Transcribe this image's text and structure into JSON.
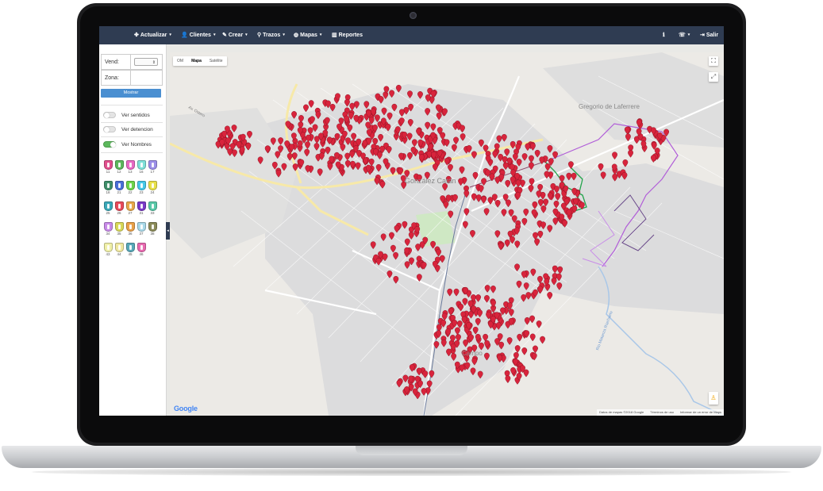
{
  "navbar": {
    "items": [
      {
        "label": "Actualizar",
        "icon": "refresh-icon",
        "glyph": "✤",
        "caret": true
      },
      {
        "label": "Clientes",
        "icon": "user-icon",
        "glyph": "👤",
        "caret": true
      },
      {
        "label": "Crear",
        "icon": "edit-icon",
        "glyph": "✎",
        "caret": true
      },
      {
        "label": "Trazos",
        "icon": "map-marker-icon",
        "glyph": "⚲",
        "caret": true
      },
      {
        "label": "Mapas",
        "icon": "globe-icon",
        "glyph": "◍",
        "caret": true
      },
      {
        "label": "Reportes",
        "icon": "bar-chart-icon",
        "glyph": "▥",
        "caret": false
      }
    ],
    "right": {
      "info_glyph": "ℹ",
      "phone_glyph": "☏",
      "logout_label": "Salir",
      "logout_glyph": "⇥"
    }
  },
  "sidebar": {
    "vend_label": "Vend:",
    "vend_value": "",
    "zona_label": "Zona:",
    "zona_value": "",
    "mostrar_label": "Mostrar",
    "toggles": [
      {
        "label": "Ver sentidos",
        "on": false
      },
      {
        "label": "Ver detencion",
        "on": false
      },
      {
        "label": "Ver Nombres",
        "on": true
      }
    ],
    "vendors": [
      {
        "num": "11",
        "color": "#e14f8d"
      },
      {
        "num": "12",
        "color": "#5cb85c"
      },
      {
        "num": "13",
        "color": "#e86ac4"
      },
      {
        "num": "16",
        "color": "#7fe0d8"
      },
      {
        "num": "17",
        "color": "#9b8ee8"
      },
      {
        "num": "18",
        "color": "#3f8f6a"
      },
      {
        "num": "21",
        "color": "#4a6fd8"
      },
      {
        "num": "22",
        "color": "#6cd44a"
      },
      {
        "num": "23",
        "color": "#46c8e8"
      },
      {
        "num": "24",
        "color": "#e8e04a"
      },
      {
        "num": "25",
        "color": "#3aa8b8"
      },
      {
        "num": "26",
        "color": "#e84a5a"
      },
      {
        "num": "27",
        "color": "#e8a84a"
      },
      {
        "num": "31",
        "color": "#7a3ac8"
      },
      {
        "num": "33",
        "color": "#58c8a8"
      },
      {
        "num": "34",
        "color": "#c88ae8"
      },
      {
        "num": "35",
        "color": "#d8d858"
      },
      {
        "num": "36",
        "color": "#e8a048"
      },
      {
        "num": "37",
        "color": "#a8d8e8"
      },
      {
        "num": "38",
        "color": "#8a8a58"
      },
      {
        "num": "43",
        "color": "#f0f0a8"
      },
      {
        "num": "44",
        "color": "#f0e8a0"
      },
      {
        "num": "45",
        "color": "#58a8b8"
      },
      {
        "num": "46",
        "color": "#e86ab0"
      }
    ]
  },
  "map": {
    "types": [
      "OM",
      "Mapa",
      "Satélite"
    ],
    "active_type": "Mapa",
    "labels": {
      "city_main": "González Catán",
      "city_north": "Gregorio de Laferrere",
      "city_south": "Campo",
      "road": "Av. Ostero",
      "river": "Río Matanza Riachuelo"
    },
    "footer": [
      "Datos de mapas ©2018 Google",
      "Términos de uso",
      "Informar de un error de Maps"
    ],
    "google": "Google",
    "marker_color": "#d8243c"
  }
}
